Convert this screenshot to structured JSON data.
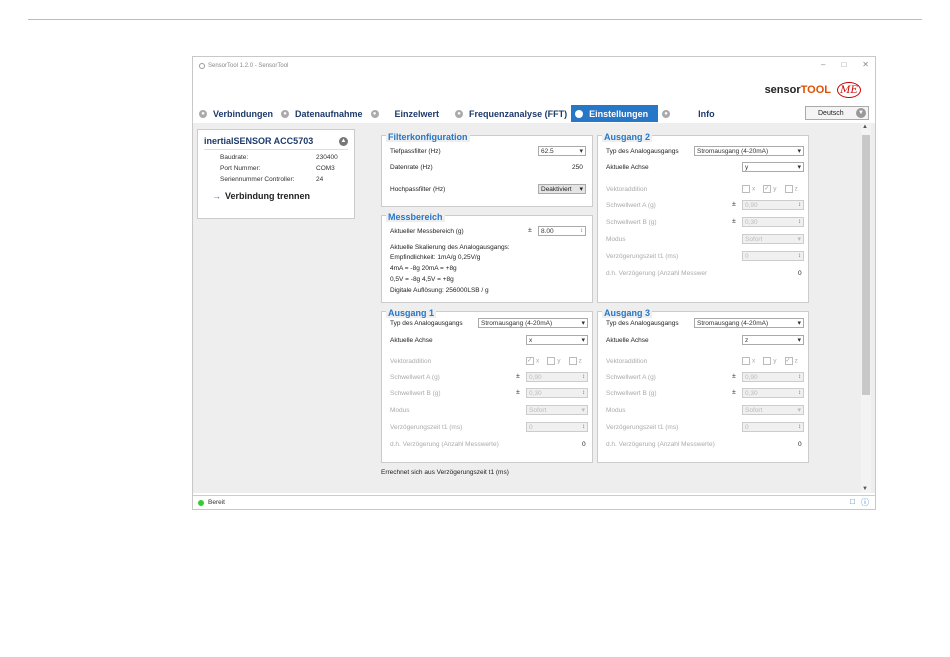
{
  "window": {
    "title": "SensorTool 1.2.0 - SensorTool",
    "min": "–",
    "max": "□",
    "close": "✕"
  },
  "logo": {
    "sensor": "sensor",
    "tool": "TOOL",
    "me": "ME"
  },
  "tabs": [
    {
      "label": "Verbindungen"
    },
    {
      "label": "Datenaufnahme"
    },
    {
      "label": "Einzelwert"
    },
    {
      "label": "Frequenzanalyse (FFT)"
    },
    {
      "label": "Einstellungen",
      "active": true
    },
    {
      "label": "Info"
    }
  ],
  "language": "Deutsch",
  "connection": {
    "title": "inertialSENSOR ACC5703",
    "rows": [
      {
        "k": "Baudrate:",
        "v": "230400"
      },
      {
        "k": "Port Nummer:",
        "v": "COM3"
      },
      {
        "k": "Seriennummer Controller:",
        "v": "24"
      }
    ],
    "disconnect": "Verbindung trennen"
  },
  "filter": {
    "title": "Filterkonfiguration",
    "tp_label": "Tiefpassfilter (Hz)",
    "tp_val": "62.5",
    "rate_label": "Datenrate (Hz)",
    "rate_val": "250",
    "hp_label": "Hochpassfilter (Hz)",
    "hp_val": "Deaktiviert"
  },
  "range": {
    "title": "Messbereich",
    "label": "Aktueller Messbereich (g)",
    "pm": "±",
    "val": "8.00",
    "lines": [
      "Aktuelle Skalierung des Analogausgangs:",
      "Empfindlichkeit: 1mA/g 0,25V/g",
      "4mA = -8g        20mA = +8g",
      "0,5V = -8g        4,5V = +8g",
      "Digitale Auflösung: 256000LSB / g"
    ]
  },
  "labels": {
    "type": "Typ des Analogausgangs",
    "axis": "Aktuelle Achse",
    "vec": "Vektoraddition",
    "swa": "Schwellwert A (g)",
    "swb": "Schwellwert B (g)",
    "mode": "Modus",
    "delay": "Verzögerungszeit t1 (ms)",
    "dh": "d.h. Verzögerung (Anzahl Messwerte)",
    "pm": "±",
    "x": "x",
    "y": "y",
    "z": "z"
  },
  "out1": {
    "title": "Ausgang 1",
    "type": "Stromausgang (4-20mA)",
    "axis": "x",
    "swa": "0,90",
    "swb": "0,30",
    "mode": "Sofort",
    "delay": "0",
    "dh": "0"
  },
  "out2": {
    "title": "Ausgang 2",
    "type": "Stromausgang (4-20mA)",
    "axis": "y",
    "swa": "0,90",
    "swb": "0,30",
    "mode": "Sofort",
    "delay": "0",
    "dh": "0",
    "dh_label": "d.h. Verzögerung (Anzahl Messwer"
  },
  "out3": {
    "title": "Ausgang 3",
    "type": "Stromausgang (4-20mA)",
    "axis": "z",
    "swa": "0,90",
    "swb": "0,30",
    "mode": "Sofort",
    "delay": "0",
    "dh": "0"
  },
  "note": "Errechnet sich aus Verzögerungszeit t1 (ms)",
  "status": "Bereit",
  "colors": {
    "accent": "#2777c9",
    "heading": "#1d3a6b",
    "ok": "#33cc33"
  }
}
